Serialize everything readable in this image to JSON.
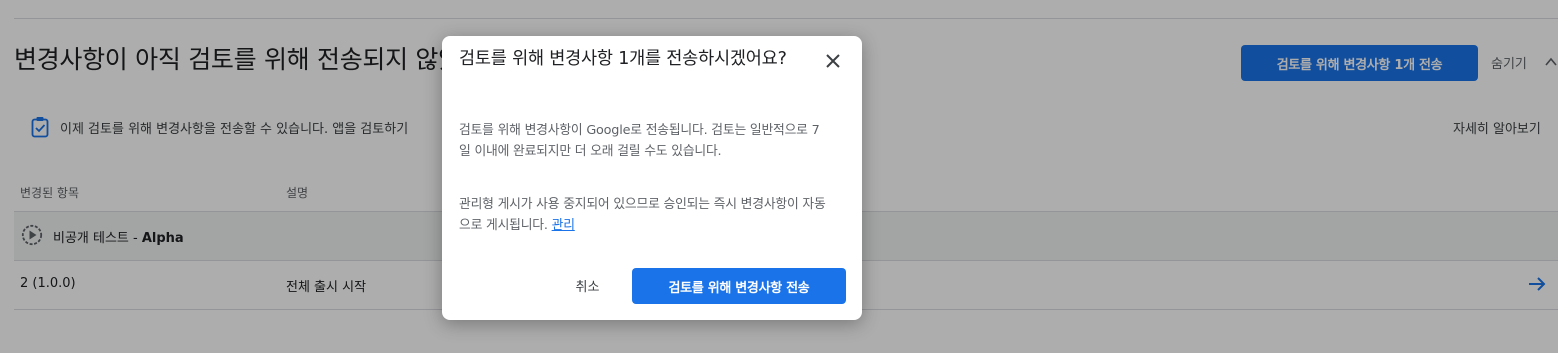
{
  "page": {
    "headline": "변경사항이 아직 검토를 위해 전송되지 않았습니다",
    "send_button_label": "검토를 위해 변경사항 1개 전송",
    "hide_label": "숨기기",
    "info_text": "이제 검토를 위해 변경사항을 전송할 수 있습니다. 앱을 검토하기",
    "learn_more_label": "자세히 알아보기",
    "columns": [
      "변경된 항목",
      "설명"
    ],
    "group": {
      "prefix": "비공개 테스트 - ",
      "name": "Alpha"
    },
    "row": {
      "item": "2 (1.0.0)",
      "description": "전체 출시 시작"
    }
  },
  "dialog": {
    "title": "검토를 위해 변경사항 1개를 전송하시겠어요?",
    "paragraph1": "검토를 위해 변경사항이 Google로 전송됩니다. 검토는 일반적으로 7일 이내에 완료되지만 더 오래 걸릴 수도 있습니다.",
    "paragraph2": "관리형 게시가 사용 중지되어 있으므로 승인되는 즉시 변경사항이 자동으로 게시됩니다.",
    "manage_link": "관리",
    "cancel_label": "취소",
    "confirm_label": "검토를 위해 변경사항 전송"
  },
  "icons": {
    "close": "close-icon",
    "chevron": "chevron-up-icon",
    "info": "clipboard-check-icon",
    "track": "play-circle-icon",
    "arrow": "arrow-right-icon"
  },
  "colors": {
    "accent": "#1a73e8",
    "scrim": "rgba(0,0,0,0.32)"
  }
}
